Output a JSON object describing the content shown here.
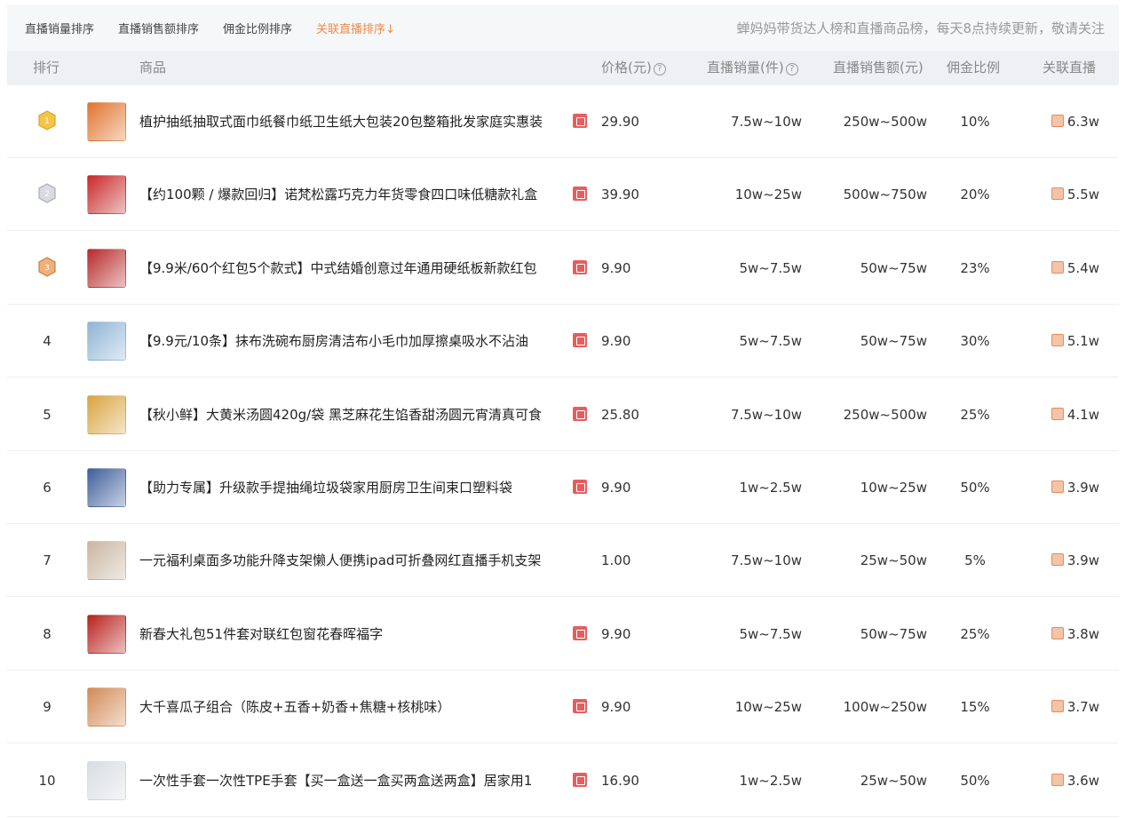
{
  "sort_tabs": [
    {
      "label": "直播销量排序",
      "active": false
    },
    {
      "label": "直播销售额排序",
      "active": false
    },
    {
      "label": "佣金比例排序",
      "active": false
    },
    {
      "label": "关联直播排序",
      "active": true,
      "arrow": "↓"
    }
  ],
  "notice": "蝉妈妈带货达人榜和直播商品榜，每天8点持续更新，敬请关注",
  "columns": {
    "rank": "排行",
    "product": "商品",
    "price": "价格(元)",
    "sales": "直播销量(件)",
    "amount": "直播销售额(元)",
    "commission": "佣金比例",
    "live": "关联直播"
  },
  "help_glyph": "?",
  "rows": [
    {
      "rank": "1",
      "medal": "gold",
      "name": "植护抽纸抽取式面巾纸餐巾纸卫生纸大包装20包整箱批发家庭实惠装",
      "shop": true,
      "price": "29.90",
      "sales": "7.5w~10w",
      "amount": "250w~500w",
      "commission": "10%",
      "live": "6.3w",
      "thumb": "#e2742e"
    },
    {
      "rank": "2",
      "medal": "silver",
      "name": "【约100颗 / 爆款回归】诺梵松露巧克力年货零食四口味低糖款礼盒",
      "shop": true,
      "price": "39.90",
      "sales": "10w~25w",
      "amount": "500w~750w",
      "commission": "20%",
      "live": "5.5w",
      "thumb": "#c8292a"
    },
    {
      "rank": "3",
      "medal": "bronze",
      "name": "【9.9米/60个红包5个款式】中式结婚创意过年通用硬纸板新款红包",
      "shop": true,
      "price": "9.90",
      "sales": "5w~7.5w",
      "amount": "50w~75w",
      "commission": "23%",
      "live": "5.4w",
      "thumb": "#b82a2a"
    },
    {
      "rank": "4",
      "medal": "",
      "name": "【9.9元/10条】抹布洗碗布厨房清洁布小毛巾加厚擦桌吸水不沾油",
      "shop": true,
      "price": "9.90",
      "sales": "5w~7.5w",
      "amount": "50w~75w",
      "commission": "30%",
      "live": "5.1w",
      "thumb": "#8fb5d6"
    },
    {
      "rank": "5",
      "medal": "",
      "name": "【秋小鲜】大黄米汤圆420g/袋 黑芝麻花生馅香甜汤圆元宵清真可食",
      "shop": true,
      "price": "25.80",
      "sales": "7.5w~10w",
      "amount": "250w~500w",
      "commission": "25%",
      "live": "4.1w",
      "thumb": "#d9a441"
    },
    {
      "rank": "6",
      "medal": "",
      "name": "【助力专属】升级款手提抽绳垃圾袋家用厨房卫生间束口塑料袋",
      "shop": true,
      "price": "9.90",
      "sales": "1w~2.5w",
      "amount": "10w~25w",
      "commission": "50%",
      "live": "3.9w",
      "thumb": "#3e5f9a"
    },
    {
      "rank": "7",
      "medal": "",
      "name": "一元福利桌面多功能升降支架懒人便携ipad可折叠网红直播手机支架",
      "shop": false,
      "price": "1.00",
      "sales": "7.5w~10w",
      "amount": "25w~50w",
      "commission": "5%",
      "live": "3.9w",
      "thumb": "#c9b6a0"
    },
    {
      "rank": "8",
      "medal": "",
      "name": "新春大礼包51件套对联红包窗花春晖福字",
      "shop": true,
      "price": "9.90",
      "sales": "5w~7.5w",
      "amount": "50w~75w",
      "commission": "25%",
      "live": "3.8w",
      "thumb": "#b8221e"
    },
    {
      "rank": "9",
      "medal": "",
      "name": "大千喜瓜子组合（陈皮+五香+奶香+焦糖+核桃味）",
      "shop": true,
      "price": "9.90",
      "sales": "10w~25w",
      "amount": "100w~250w",
      "commission": "15%",
      "live": "3.7w",
      "thumb": "#d38a56"
    },
    {
      "rank": "10",
      "medal": "",
      "name": "一次性手套一次性TPE手套【买一盒送一盒买两盒送两盒】居家用1",
      "shop": true,
      "price": "16.90",
      "sales": "1w~2.5w",
      "amount": "25w~50w",
      "commission": "50%",
      "live": "3.6w",
      "thumb": "#d8dde2"
    }
  ]
}
